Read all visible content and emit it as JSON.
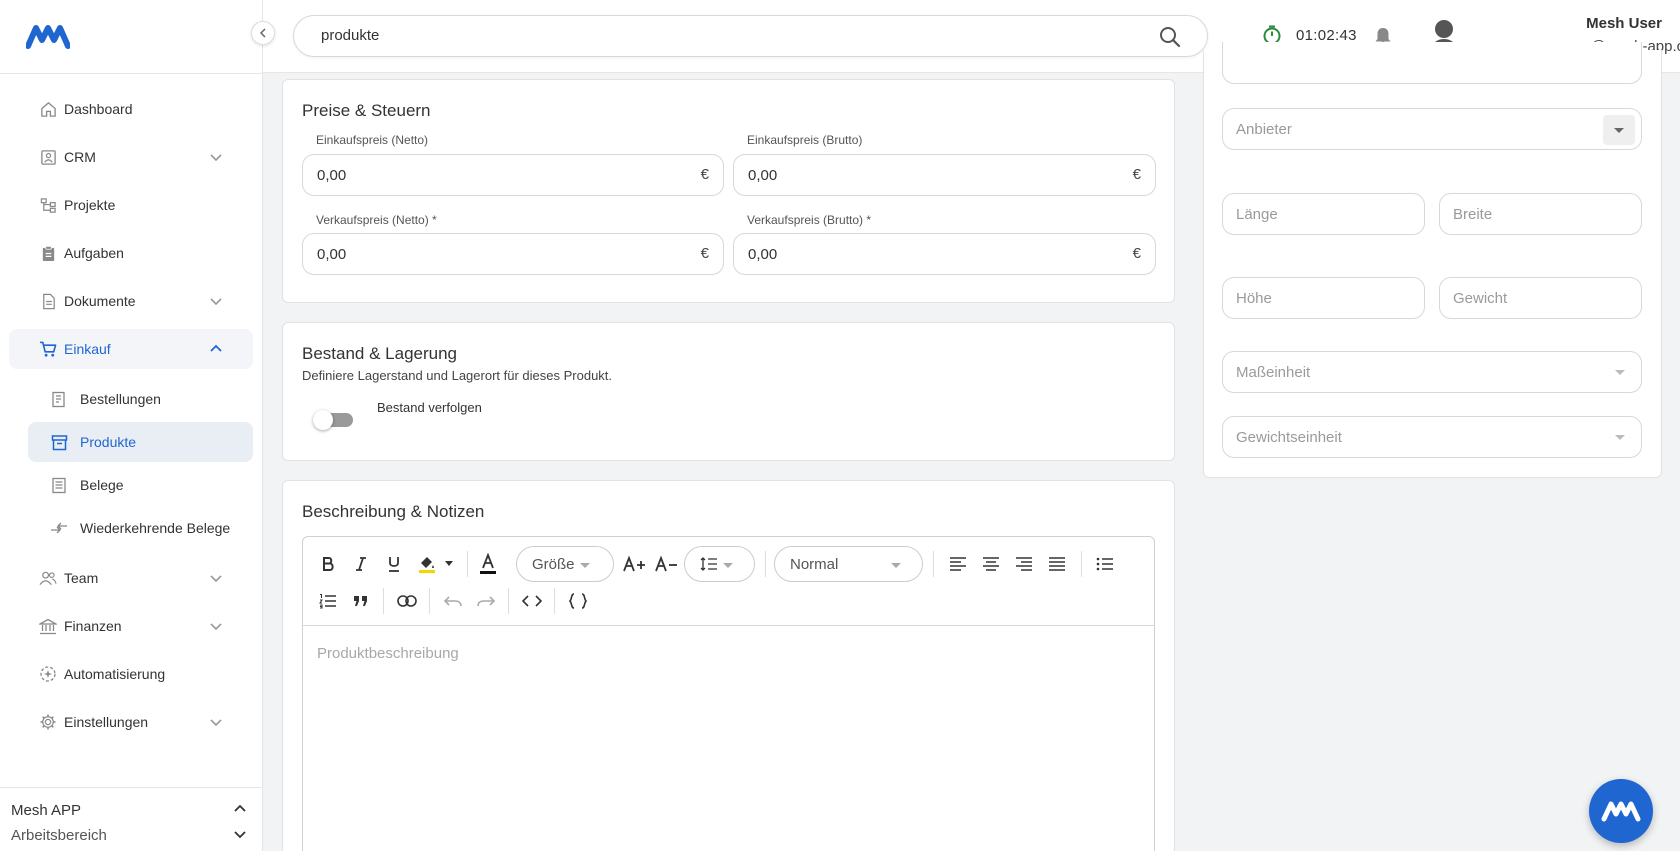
{
  "sidebar": {
    "items": [
      {
        "label": "Dashboard"
      },
      {
        "label": "CRM"
      },
      {
        "label": "Projekte"
      },
      {
        "label": "Aufgaben"
      },
      {
        "label": "Dokumente"
      },
      {
        "label": "Einkauf"
      },
      {
        "label": "Team"
      },
      {
        "label": "Finanzen"
      },
      {
        "label": "Automatisierung"
      },
      {
        "label": "Einstellungen"
      }
    ],
    "einkauf_sub": [
      {
        "label": "Bestellungen"
      },
      {
        "label": "Produkte"
      },
      {
        "label": "Belege"
      },
      {
        "label": "Wiederkehrende Belege"
      }
    ],
    "workspace": {
      "name": "Mesh APP",
      "sub": "Arbeitsbereich"
    }
  },
  "header": {
    "search_value": "produkte",
    "timer": "01:02:43",
    "user_name": "Mesh User",
    "user_email": "user@mesh-app.com"
  },
  "prices": {
    "title": "Preise & Steuern",
    "fields": [
      {
        "label": "Einkaufspreis (Netto)",
        "value": "0,00",
        "unit": "€"
      },
      {
        "label": "Einkaufspreis (Brutto)",
        "value": "0,00",
        "unit": "€"
      },
      {
        "label": "Verkaufspreis (Netto) *",
        "value": "0,00",
        "unit": "€"
      },
      {
        "label": "Verkaufspreis (Brutto) *",
        "value": "0,00",
        "unit": "€"
      }
    ]
  },
  "stock": {
    "title": "Bestand & Lagerung",
    "subtitle": "Definiere Lagerstand und Lagerort für dieses Produkt.",
    "toggle_label": "Bestand verfolgen"
  },
  "description": {
    "title": "Beschreibung & Notizen",
    "size_select": "Größe",
    "style_select": "Normal",
    "placeholder": "Produktbeschreibung"
  },
  "right_panel": {
    "anbieter": "Anbieter",
    "laenge": "Länge",
    "breite": "Breite",
    "hoehe": "Höhe",
    "gewicht": "Gewicht",
    "masseinheit": "Maßeinheit",
    "gewichtseinheit": "Gewichtseinheit"
  },
  "colors": {
    "accent": "#1f66d1",
    "timer": "#2e8b3d"
  }
}
